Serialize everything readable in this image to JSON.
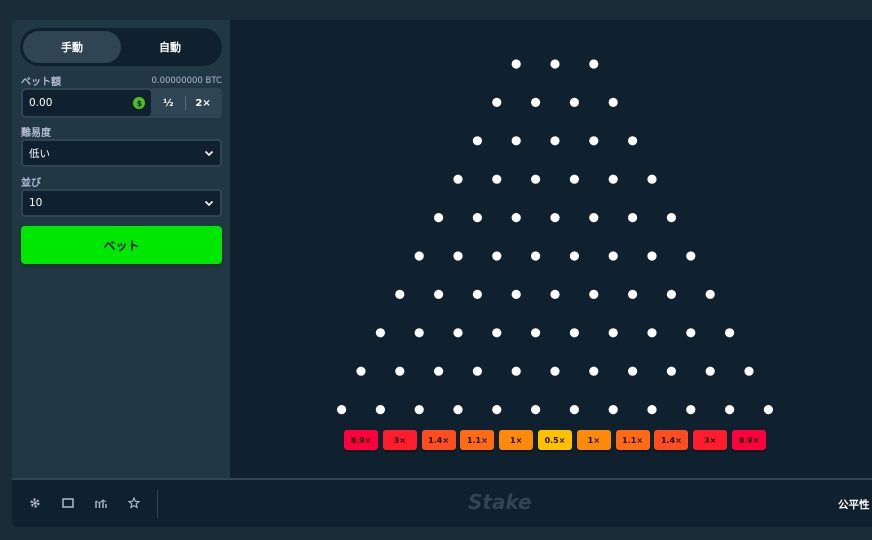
{
  "sidebar": {
    "tabs": [
      {
        "label": "手動",
        "active": true
      },
      {
        "label": "自動",
        "active": false
      }
    ],
    "bet_amount": {
      "label": "ベット額",
      "balance": "0.00000000 BTC",
      "value": "0.00",
      "currency_icon": "bitcoin-coin-icon",
      "half_label": "½",
      "double_label": "2×"
    },
    "difficulty": {
      "label": "難易度",
      "selected": "低い"
    },
    "rows": {
      "label": "並び",
      "selected": "10"
    },
    "bet_button_label": "ベット"
  },
  "game": {
    "peg_rows": [
      3,
      4,
      5,
      6,
      7,
      8,
      9,
      10,
      11,
      12
    ],
    "multipliers": [
      {
        "label": "8.9×",
        "color": "#ff003f"
      },
      {
        "label": "3×",
        "color": "#ff1d2d"
      },
      {
        "label": "1.4×",
        "color": "#ff4d1f"
      },
      {
        "label": "1.1×",
        "color": "#ff6a14"
      },
      {
        "label": "1×",
        "color": "#ff8a0a"
      },
      {
        "label": "0.5×",
        "color": "#ffc000"
      },
      {
        "label": "1×",
        "color": "#ff8a0a"
      },
      {
        "label": "1.1×",
        "color": "#ff6a14"
      },
      {
        "label": "1.4×",
        "color": "#ff4d1f"
      },
      {
        "label": "3×",
        "color": "#ff1d2d"
      },
      {
        "label": "8.9×",
        "color": "#ff003f"
      }
    ]
  },
  "footer": {
    "icons": [
      "settings-icon",
      "fullscreen-icon",
      "stats-icon",
      "star-icon"
    ],
    "logo": "Stake",
    "fairness_label": "公平性"
  },
  "colors": {
    "accent_green": "#00e701",
    "panel": "#213743",
    "background": "#0f212e"
  }
}
